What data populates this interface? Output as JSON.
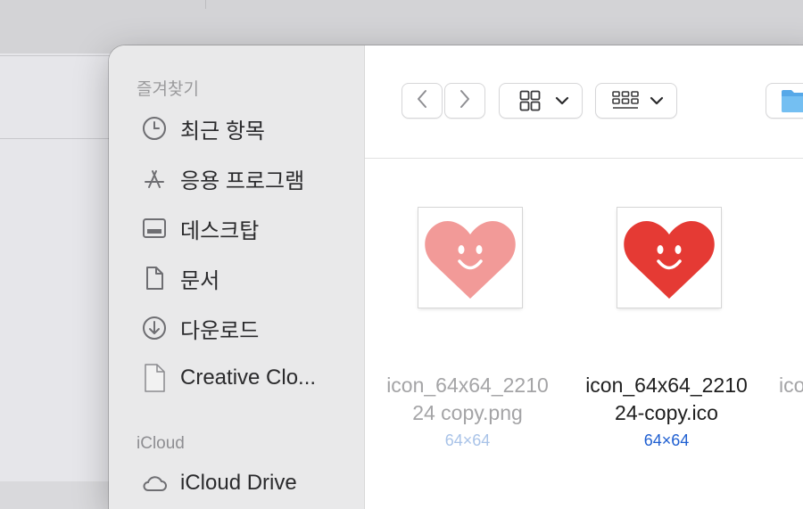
{
  "sidebar": {
    "favorites_title": "즐겨찾기",
    "items": [
      {
        "label": "최근 항목",
        "icon": "clock-icon"
      },
      {
        "label": "응용 프로그램",
        "icon": "applications-icon"
      },
      {
        "label": "데스크탑",
        "icon": "desktop-icon"
      },
      {
        "label": "문서",
        "icon": "document-icon"
      },
      {
        "label": "다운로드",
        "icon": "download-icon"
      },
      {
        "label": "Creative Clo...",
        "icon": "file-icon"
      }
    ],
    "icloud_title": "iCloud",
    "icloud_items": [
      {
        "label": "iCloud Drive",
        "icon": "cloud-icon"
      }
    ]
  },
  "toolbar": {
    "back_icon": "chevron-left-icon",
    "forward_icon": "chevron-right-icon",
    "view_icon": "grid-view-icon",
    "group_icon": "group-icon",
    "folder_icon": "folder-icon"
  },
  "files": [
    {
      "name_line1": "icon_64x64_2210",
      "name_line2": "24 copy.png",
      "dims": "64×64",
      "heart_color": "#f29a98",
      "dimmed": true
    },
    {
      "name_line1": "icon_64x64_2210",
      "name_line2": "24-copy.ico",
      "dims": "64×64",
      "heart_color": "#e53a34",
      "dimmed": false
    },
    {
      "name_line1": "ico",
      "dimmed": true
    }
  ],
  "colors": {
    "accent": "#1f5fd1",
    "accent_dim": "#a9c3e8",
    "text_dim": "#a4a4a6",
    "text": "#1e1e1e"
  }
}
